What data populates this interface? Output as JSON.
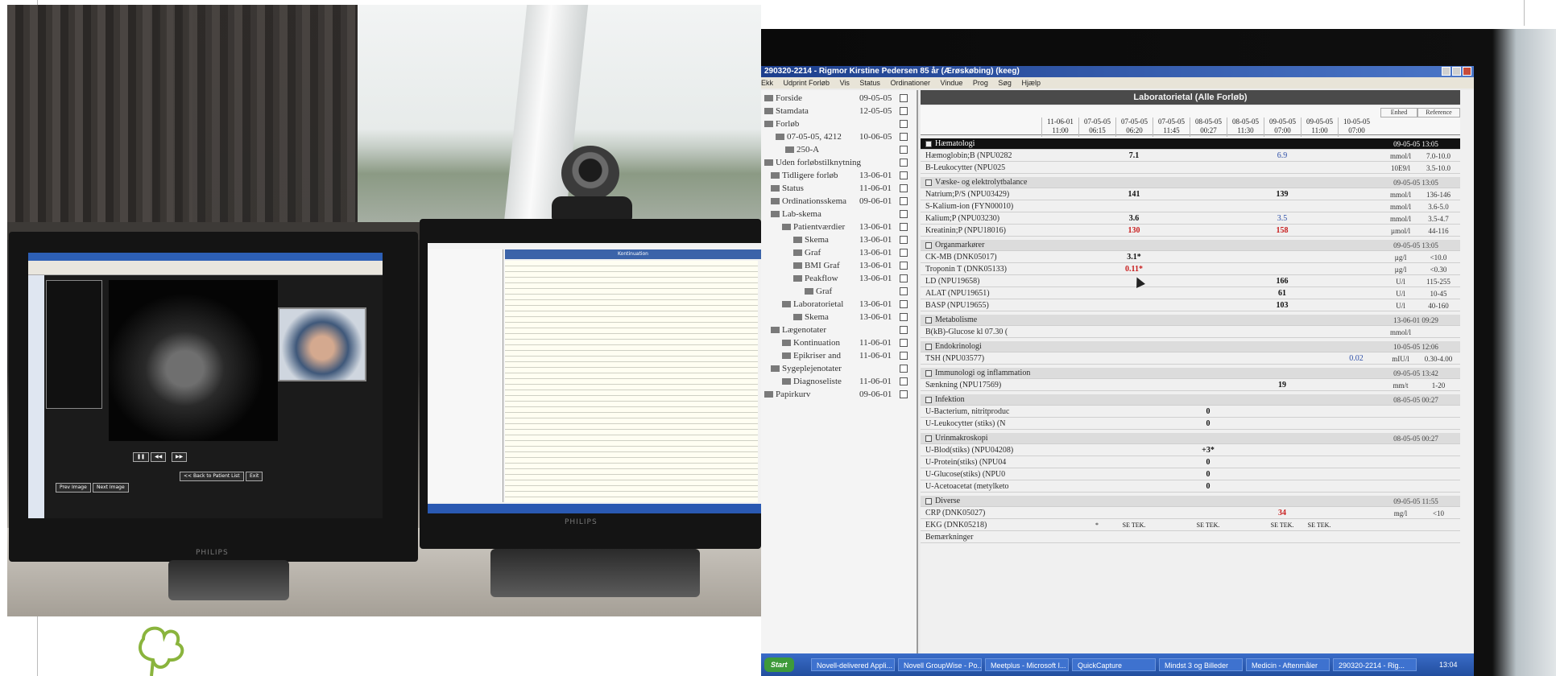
{
  "lab_window": {
    "title": "290320-2214 - Rigmor Kirstine Pedersen  85 år (Ærøskøbing) (keeg)",
    "menu": [
      "Ekk",
      "Udprint Forløb",
      "Vis",
      "Status",
      "Ordinationer",
      "Vindue",
      "Prog",
      "Søg",
      "Hjælp"
    ],
    "panel_title": "Laboratorietal (Alle Forløb)",
    "tail_headers": {
      "unit": "Enhed",
      "ref": "Reference"
    },
    "columns": [
      {
        "date": "11-06-01",
        "time": "11:00"
      },
      {
        "date": "07-05-05",
        "time": "06:15"
      },
      {
        "date": "07-05-05",
        "time": "06:20"
      },
      {
        "date": "07-05-05",
        "time": "11:45"
      },
      {
        "date": "08-05-05",
        "time": "00:27"
      },
      {
        "date": "08-05-05",
        "time": "11:30"
      },
      {
        "date": "09-05-05",
        "time": "07:00"
      },
      {
        "date": "09-05-05",
        "time": "11:00"
      },
      {
        "date": "10-05-05",
        "time": "07:00"
      }
    ],
    "tree": [
      {
        "label": "Forside",
        "date": "09-05-05"
      },
      {
        "label": "Stamdata",
        "date": "12-05-05"
      },
      {
        "label": "Forløb",
        "date": ""
      },
      {
        "label": "07-05-05, 4212",
        "date": "10-06-05"
      },
      {
        "label": "250-A",
        "date": ""
      },
      {
        "label": "Uden forløbstilknytning",
        "date": ""
      },
      {
        "label": "Tidligere forløb",
        "date": "13-06-01"
      },
      {
        "label": "Status",
        "date": "11-06-01"
      },
      {
        "label": "Ordinationsskema",
        "date": "09-06-01"
      },
      {
        "label": "Lab-skema",
        "date": ""
      },
      {
        "label": "Patientværdier",
        "date": "13-06-01"
      },
      {
        "label": "Skema",
        "date": "13-06-01"
      },
      {
        "label": "Graf",
        "date": "13-06-01"
      },
      {
        "label": "BMI Graf",
        "date": "13-06-01"
      },
      {
        "label": "Peakflow",
        "date": "13-06-01"
      },
      {
        "label": "Graf",
        "date": ""
      },
      {
        "label": "Laboratorietal",
        "date": "13-06-01"
      },
      {
        "label": "Skema",
        "date": "13-06-01"
      },
      {
        "label": "Lægenotater",
        "date": ""
      },
      {
        "label": "Kontinuation",
        "date": "11-06-01"
      },
      {
        "label": "Epikriser and",
        "date": "11-06-01"
      },
      {
        "label": "Sygeplejenotater",
        "date": ""
      },
      {
        "label": "Diagnoseliste",
        "date": "11-06-01"
      },
      {
        "label": "Papirkurv",
        "date": "09-06-01"
      }
    ],
    "sections": [
      {
        "title": "Hæmatologi",
        "timestamp": "09-05-05 13:05",
        "dark": true,
        "rows": [
          {
            "name": "Hæmoglobin;B (NPU0282",
            "values": {
              "2": "7.1",
              "6": "6.9"
            },
            "unit": "mmol/l",
            "ref": "7.0-10.0"
          },
          {
            "name": "B-Leukocytter (NPU025",
            "values": {},
            "unit": "10E9/l",
            "ref": "3.5-10.0"
          }
        ]
      },
      {
        "title": "Væske- og elektrolytbalance",
        "timestamp": "09-05-05 13:05",
        "dark": false,
        "rows": [
          {
            "name": "Natrium;P/S (NPU03429)",
            "values": {
              "2": "141",
              "6": "139"
            },
            "unit": "mmol/l",
            "ref": "136-146"
          },
          {
            "name": "S-Kalium-ion (FYN00010)",
            "values": {},
            "unit": "mmol/l",
            "ref": "3.6-5.0"
          },
          {
            "name": "Kalium;P (NPU03230)",
            "values": {
              "2": "3.6",
              "6": "3.5"
            },
            "unit": "mmol/l",
            "ref": "3.5-4.7"
          },
          {
            "name": "Kreatinin;P (NPU18016)",
            "values": {
              "2": "130",
              "6": "158"
            },
            "unit": "µmol/l",
            "ref": "44-116"
          }
        ]
      },
      {
        "title": "Organmarkører",
        "timestamp": "09-05-05 13:05",
        "dark": false,
        "rows": [
          {
            "name": "CK-MB (DNK05017)",
            "values": {
              "2": "3.1*"
            },
            "unit": "µg/l",
            "ref": "<10.0"
          },
          {
            "name": "Troponin T (DNK05133)",
            "values": {
              "2": "0.11*"
            },
            "unit": "µg/l",
            "ref": "<0.30"
          },
          {
            "name": "LD (NPU19658)",
            "values": {
              "6": "166"
            },
            "unit": "U/l",
            "ref": "115-255"
          },
          {
            "name": "ALAT (NPU19651)",
            "values": {
              "6": "61"
            },
            "unit": "U/l",
            "ref": "10-45"
          },
          {
            "name": "BASP (NPU19655)",
            "values": {
              "6": "103"
            },
            "unit": "U/l",
            "ref": "40-160"
          }
        ]
      },
      {
        "title": "Metabolisme",
        "timestamp": "13-06-01 09:29",
        "dark": false,
        "rows": [
          {
            "name": "B(kB)-Glucose kl 07.30 (",
            "values": {},
            "unit": "mmol/l",
            "ref": ""
          }
        ]
      },
      {
        "title": "Endokrinologi",
        "timestamp": "10-05-05 12:06",
        "dark": false,
        "rows": [
          {
            "name": "TSH (NPU03577)",
            "values": {
              "8": "0.02"
            },
            "unit": "mIU/l",
            "ref": "0.30-4.00"
          }
        ]
      },
      {
        "title": "Immunologi og inflammation",
        "timestamp": "09-05-05 13:42",
        "dark": false,
        "rows": [
          {
            "name": "Sænkning (NPU17569)",
            "values": {
              "6": "19"
            },
            "unit": "mm/t",
            "ref": "1-20"
          }
        ]
      },
      {
        "title": "Infektion",
        "timestamp": "08-05-05 00:27",
        "dark": false,
        "rows": [
          {
            "name": "U-Bacterium, nitritproduc",
            "values": {
              "4": "0"
            },
            "unit": "",
            "ref": ""
          },
          {
            "name": "U-Leukocytter (stiks) (N",
            "values": {
              "4": "0"
            },
            "unit": "",
            "ref": ""
          }
        ]
      },
      {
        "title": "Urinmakroskopi",
        "timestamp": "08-05-05 00:27",
        "dark": false,
        "rows": [
          {
            "name": "U-Blod(stiks) (NPU04208)",
            "values": {
              "4": "+3*"
            },
            "unit": "",
            "ref": ""
          },
          {
            "name": "U-Protein(stiks) (NPU04",
            "values": {
              "4": "0"
            },
            "unit": "",
            "ref": ""
          },
          {
            "name": "U-Glucose(stiks) (NPU0",
            "values": {
              "4": "0"
            },
            "unit": "",
            "ref": ""
          },
          {
            "name": "U-Acetoacetat (metylketo",
            "values": {
              "4": "0"
            },
            "unit": "",
            "ref": ""
          }
        ]
      },
      {
        "title": "Diverse",
        "timestamp": "09-05-05 11:55",
        "dark": false,
        "rows": [
          {
            "name": "CRP (DNK05027)",
            "values": {
              "6": "34"
            },
            "unit": "mg/l",
            "ref": "<10"
          },
          {
            "name": "EKG (DNK05218)",
            "values": {
              "1": "*",
              "2": "SE TEK.",
              "4": "SE TEK.",
              "6": "SE TEK.",
              "7": "SE TEK."
            },
            "unit": "",
            "ref": ""
          },
          {
            "name": "Bemærkninger",
            "values": {},
            "unit": "",
            "ref": ""
          }
        ]
      }
    ],
    "taskbar": {
      "start": "Start",
      "tasks": [
        "Novell-delivered Appli...",
        "Novell GroupWise - Po...",
        "Meetplus - Microsoft I...",
        "QuickCapture",
        "Mindst 3 og Billeder",
        "Medicin - Aftenmåler",
        "290320-2214 - Rig..."
      ],
      "clock": "13:04"
    }
  },
  "left_monitor": {
    "buttons": [
      "Prev Image",
      "Next Image",
      "<< Back to Patient List",
      "Exit"
    ],
    "brand": "PHILIPS"
  },
  "middle_monitor": {
    "title": "Kontinuation",
    "brand": "PHILIPS"
  }
}
